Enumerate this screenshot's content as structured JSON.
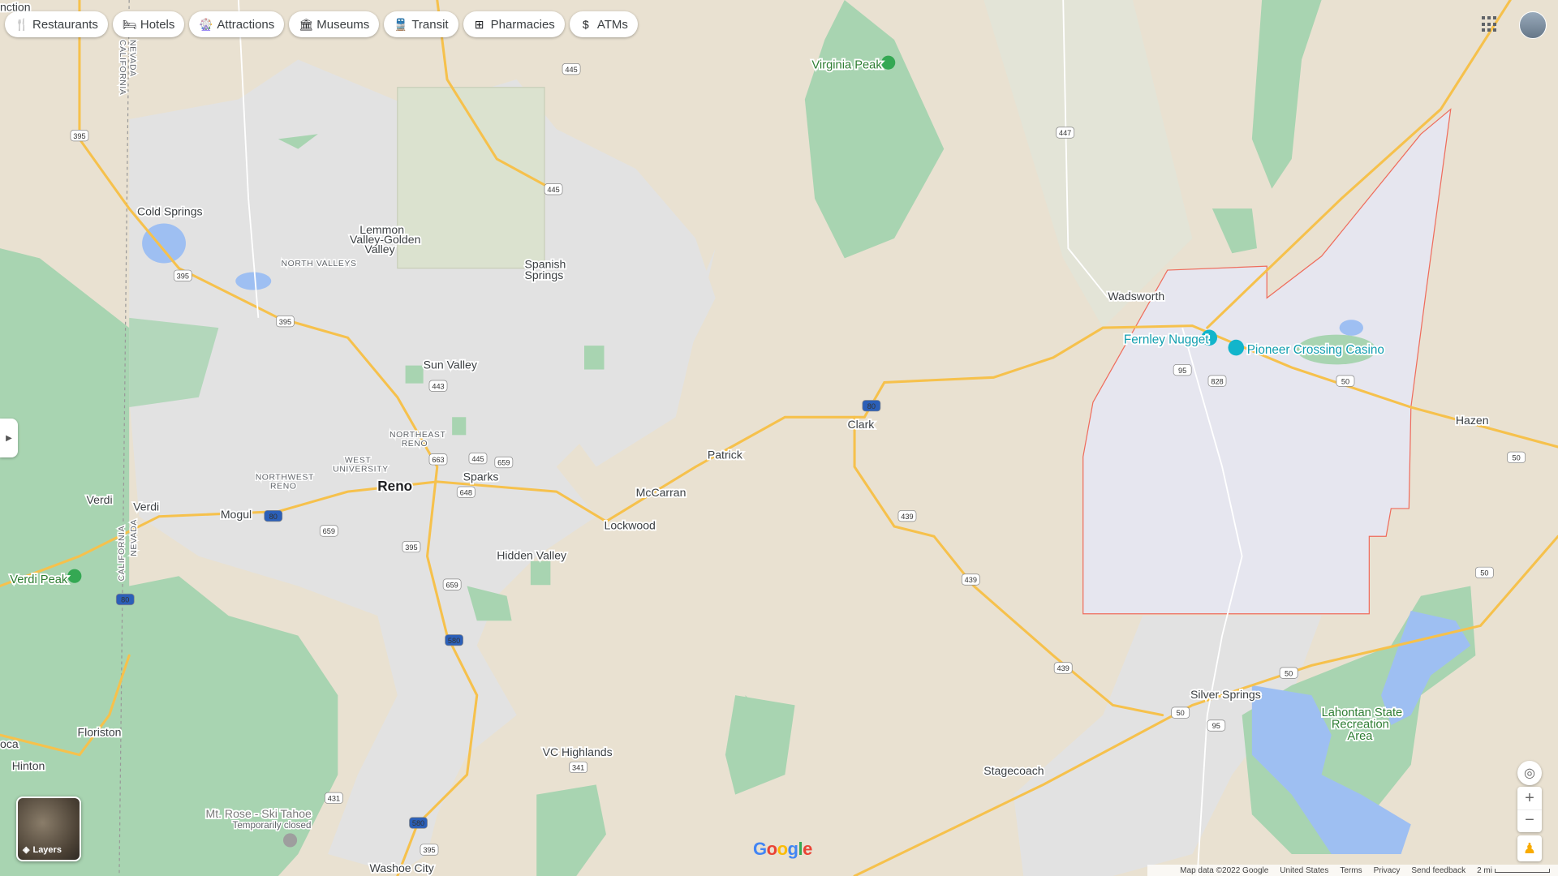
{
  "chips": [
    {
      "label": "Restaurants",
      "icon": "fork-knife-icon",
      "glyph": "🍴"
    },
    {
      "label": "Hotels",
      "icon": "bed-icon",
      "glyph": "🛏"
    },
    {
      "label": "Attractions",
      "icon": "ferris-wheel-icon",
      "glyph": "🎡"
    },
    {
      "label": "Museums",
      "icon": "museum-icon",
      "glyph": "🏛"
    },
    {
      "label": "Transit",
      "icon": "train-icon",
      "glyph": "🚆"
    },
    {
      "label": "Pharmacies",
      "icon": "pharmacy-icon",
      "glyph": "⊞"
    },
    {
      "label": "ATMs",
      "icon": "atm-icon",
      "glyph": "$"
    }
  ],
  "places": {
    "reno": "Reno",
    "sparks": "Sparks",
    "sun_valley": "Sun Valley",
    "cold_springs": "Cold Springs",
    "lemmon1": "Lemmon",
    "lemmon2": "Valley-Golden",
    "lemmon3": "Valley",
    "spanish1": "Spanish",
    "spanish2": "Springs",
    "north_valleys": "NORTH VALLEYS",
    "ne_reno1": "NORTHEAST",
    "ne_reno2": "RENO",
    "west_univ1": "WEST",
    "west_univ2": "UNIVERSITY",
    "nw_reno1": "NORTHWEST",
    "nw_reno2": "RENO",
    "verdi": "Verdi",
    "verdi2": "Verdi",
    "mogul": "Mogul",
    "mccarran": "McCarran",
    "patrick": "Patrick",
    "lockwood": "Lockwood",
    "hidden_valley": "Hidden Valley",
    "clark": "Clark",
    "wadsworth": "Wadsworth",
    "hazen": "Hazen",
    "silver_springs": "Silver Springs",
    "stagecoach": "Stagecoach",
    "vc_highlands": "VC Highlands",
    "floriston": "Floriston",
    "hinton": "Hinton",
    "washoe_city": "Washoe City",
    "california": "CALIFORNIA",
    "nevada": "NEVADA",
    "junction": "nction",
    "oca": "oca",
    "nevada_top": "NEVADA",
    "california_top": "CALIFORNIA"
  },
  "pois": {
    "virginia_peak": "Virginia Peak",
    "verdi_peak": "Verdi Peak",
    "mt_rose1": "Mt. Rose - Ski Tahoe",
    "mt_rose2": "Temporarily closed",
    "fernley_nugget": "Fernley Nugget",
    "pioneer_crossing": "Pioneer Crossing Casino",
    "lahontan1": "Lahontan State",
    "lahontan2": "Recreation",
    "lahontan3": "Area"
  },
  "shields": [
    "395",
    "445",
    "447",
    "445",
    "395",
    "395",
    "443",
    "663",
    "445",
    "659",
    "648",
    "659",
    "395",
    "659",
    "580",
    "80",
    "80",
    "80",
    "439",
    "439",
    "439",
    "95",
    "828",
    "50",
    "50",
    "50",
    "50",
    "50",
    "95",
    "341",
    "431",
    "580",
    "395"
  ],
  "controls": {
    "layers_label": "Layers"
  },
  "footer": {
    "map_data": "Map data ©2022 Google",
    "region": "United States",
    "terms": "Terms",
    "privacy": "Privacy",
    "feedback": "Send feedback",
    "scale": "2 mi"
  },
  "brand": "Google",
  "colors": {
    "land": "#e9e1d1",
    "urban": "#e3e3e3",
    "park": "#a8d4b1",
    "water": "#9ebff2",
    "road": "#f6c14c",
    "boundary": "#ef6c5c",
    "fernley": "#e6e6ef"
  }
}
